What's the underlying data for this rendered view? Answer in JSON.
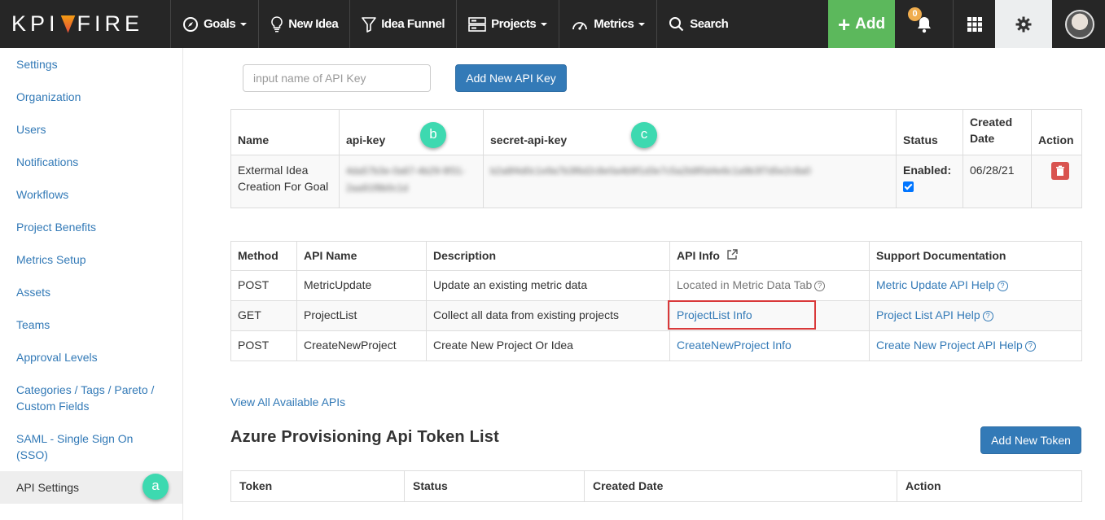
{
  "brand": {
    "logo_text_left": "KPI",
    "logo_text_right": "FIRE"
  },
  "nav": {
    "goals": "Goals",
    "new_idea": "New Idea",
    "idea_funnel": "Idea Funnel",
    "projects": "Projects",
    "metrics": "Metrics",
    "search": "Search",
    "add": "Add",
    "notification_count": "0"
  },
  "sidebar": {
    "items": [
      {
        "label": "Settings"
      },
      {
        "label": "Organization"
      },
      {
        "label": "Users"
      },
      {
        "label": "Notifications"
      },
      {
        "label": "Workflows"
      },
      {
        "label": "Project Benefits"
      },
      {
        "label": "Metrics Setup"
      },
      {
        "label": "Assets"
      },
      {
        "label": "Teams"
      },
      {
        "label": "Approval Levels"
      },
      {
        "label": "Categories / Tags / Pareto / Custom Fields"
      },
      {
        "label": "SAML - Single Sign On (SSO)"
      },
      {
        "label": "API Settings"
      }
    ]
  },
  "markers": {
    "a": "a",
    "b": "b",
    "c": "c"
  },
  "api_key_form": {
    "placeholder": "input name of API Key",
    "add_button": "Add New API Key"
  },
  "keys_table": {
    "headers": [
      "Name",
      "api-key",
      "secret-api-key",
      "Status",
      "Created Date",
      "Action"
    ],
    "row": {
      "name": "Extermal Idea Creation For Goal",
      "api_key": "4da57b3e-0a67-4b29-9f31-2aa91f8b0c1d",
      "secret_key": "b2a8f4d0c1e9a7b3f6d2c8e0a4b9f1d3e7c5a2b8f0d4e6c1a9b3f7d5e2c8a0",
      "status": "Enabled:",
      "created": "06/28/21"
    }
  },
  "api_table": {
    "headers": [
      "Method",
      "API Name",
      "Description",
      "API Info",
      "Support Documentation"
    ],
    "rows": [
      {
        "method": "POST",
        "name": "MetricUpdate",
        "description": "Update an existing metric data",
        "info": "Located in Metric Data Tab",
        "doc": "Metric Update API Help"
      },
      {
        "method": "GET",
        "name": "ProjectList",
        "description": "Collect all data from existing projects",
        "info": "ProjectList Info",
        "doc": "Project List API Help"
      },
      {
        "method": "POST",
        "name": "CreateNewProject",
        "description": "Create New Project Or Idea",
        "info": "CreateNewProject Info",
        "doc": "Create New Project API Help"
      }
    ]
  },
  "view_all": "View All Available APIs",
  "azure": {
    "title": "Azure Provisioning Api Token List",
    "add_button": "Add New Token",
    "headers": [
      "Token",
      "Status",
      "Created Date",
      "Action"
    ]
  },
  "colors": {
    "topbar": "#262626",
    "add": "#5cb85c",
    "primary": "#337ab7",
    "marker": "#3dd9b0",
    "highlight": "#d9393a",
    "danger": "#d9534f"
  }
}
